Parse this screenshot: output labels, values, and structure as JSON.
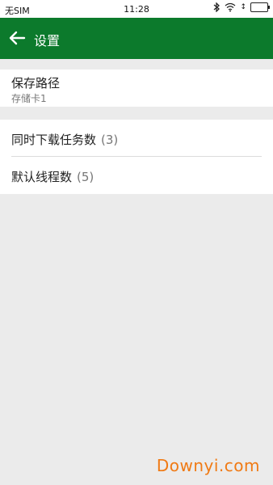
{
  "status_bar": {
    "carrier": "无SIM",
    "time": "11:28"
  },
  "app_bar": {
    "title": "设置"
  },
  "settings": {
    "save_path": {
      "title": "保存路径",
      "value": "存储卡1"
    },
    "concurrent_downloads": {
      "title": "同时下载任务数",
      "count": "(3)"
    },
    "default_threads": {
      "title": "默认线程数",
      "count": "(5)"
    }
  },
  "watermark": "Downyi.com",
  "colors": {
    "accent": "#0c7a2c",
    "background": "#ebebeb",
    "watermark": "#f07a14"
  }
}
